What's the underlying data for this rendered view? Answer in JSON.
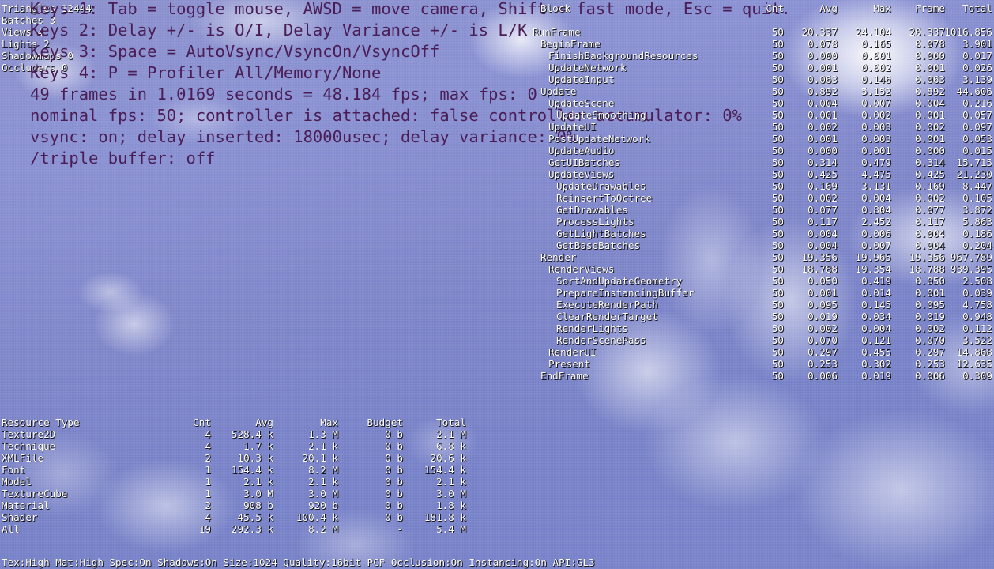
{
  "scene_stats": [
    {
      "label": "Triangles",
      "value": "12444"
    },
    {
      "label": "Batches",
      "value": "3"
    },
    {
      "label": "Views",
      "value": "4"
    },
    {
      "label": "Lights",
      "value": "2"
    },
    {
      "label": "Shadowmaps",
      "value": "0"
    },
    {
      "label": "Occluders",
      "value": "0"
    }
  ],
  "instructions": [
    "Keys 1: Tab = toggle mouse, AWSD = move camera, Shift = fast mode, Esc = quit.",
    "Keys 2: Delay +/- is O/I, Delay Variance +/- is L/K",
    "Keys 3: Space = AutoVsync/VsyncOn/VsyncOff",
    "Keys 4: P = Profiler All/Memory/None",
    "49 frames in 1.0169 seconds = 48.184 fps; max fps: 0",
    "nominal fps: 50; controller is attached: false controller accumulator: 0%",
    "vsync: on; delay inserted: 18000usec; delay variance: 0%",
    "/triple buffer: off"
  ],
  "profiler": {
    "headers": {
      "block": "Block",
      "cnt": "Cnt",
      "avg": "Avg",
      "max": "Max",
      "frame": "Frame",
      "total": "Total"
    },
    "rows": [
      {
        "block": "RunFrame",
        "depth": 0,
        "cnt": "50",
        "avg": "20.337",
        "max": "24.104",
        "frame": "20.337",
        "total": "1016.856"
      },
      {
        "block": "BeginFrame",
        "depth": 1,
        "cnt": "50",
        "avg": "0.078",
        "max": "0.165",
        "frame": "0.078",
        "total": "3.901"
      },
      {
        "block": "FinishBackgroundResources",
        "depth": 2,
        "cnt": "50",
        "avg": "0.000",
        "max": "0.001",
        "frame": "0.000",
        "total": "0.017"
      },
      {
        "block": "UpdateNetwork",
        "depth": 2,
        "cnt": "50",
        "avg": "0.001",
        "max": "0.002",
        "frame": "0.001",
        "total": "0.026"
      },
      {
        "block": "UpdateInput",
        "depth": 2,
        "cnt": "50",
        "avg": "0.063",
        "max": "0.146",
        "frame": "0.063",
        "total": "3.139"
      },
      {
        "block": "Update",
        "depth": 1,
        "cnt": "50",
        "avg": "0.892",
        "max": "5.152",
        "frame": "0.892",
        "total": "44.606"
      },
      {
        "block": "UpdateScene",
        "depth": 2,
        "cnt": "50",
        "avg": "0.004",
        "max": "0.007",
        "frame": "0.004",
        "total": "0.216"
      },
      {
        "block": "UpdateSmoothing",
        "depth": 3,
        "cnt": "50",
        "avg": "0.001",
        "max": "0.002",
        "frame": "0.001",
        "total": "0.057"
      },
      {
        "block": "UpdateUI",
        "depth": 2,
        "cnt": "50",
        "avg": "0.002",
        "max": "0.003",
        "frame": "0.002",
        "total": "0.097"
      },
      {
        "block": "PostUpdateNetwork",
        "depth": 2,
        "cnt": "50",
        "avg": "0.001",
        "max": "0.003",
        "frame": "0.001",
        "total": "0.053"
      },
      {
        "block": "UpdateAudio",
        "depth": 2,
        "cnt": "50",
        "avg": "0.000",
        "max": "0.001",
        "frame": "0.000",
        "total": "0.015"
      },
      {
        "block": "GetUIBatches",
        "depth": 2,
        "cnt": "50",
        "avg": "0.314",
        "max": "0.479",
        "frame": "0.314",
        "total": "15.715"
      },
      {
        "block": "UpdateViews",
        "depth": 2,
        "cnt": "50",
        "avg": "0.425",
        "max": "4.475",
        "frame": "0.425",
        "total": "21.230"
      },
      {
        "block": "UpdateDrawables",
        "depth": 3,
        "cnt": "50",
        "avg": "0.169",
        "max": "3.131",
        "frame": "0.169",
        "total": "8.447"
      },
      {
        "block": "ReinsertToOctree",
        "depth": 3,
        "cnt": "50",
        "avg": "0.002",
        "max": "0.004",
        "frame": "0.002",
        "total": "0.105"
      },
      {
        "block": "GetDrawables",
        "depth": 3,
        "cnt": "50",
        "avg": "0.077",
        "max": "0.804",
        "frame": "0.077",
        "total": "3.872"
      },
      {
        "block": "ProcessLights",
        "depth": 3,
        "cnt": "50",
        "avg": "0.117",
        "max": "2.452",
        "frame": "0.117",
        "total": "5.863"
      },
      {
        "block": "GetLightBatches",
        "depth": 3,
        "cnt": "50",
        "avg": "0.004",
        "max": "0.006",
        "frame": "0.004",
        "total": "0.186"
      },
      {
        "block": "GetBaseBatches",
        "depth": 3,
        "cnt": "50",
        "avg": "0.004",
        "max": "0.007",
        "frame": "0.004",
        "total": "0.204"
      },
      {
        "block": "Render",
        "depth": 1,
        "cnt": "50",
        "avg": "19.356",
        "max": "19.965",
        "frame": "19.356",
        "total": "967.789"
      },
      {
        "block": "RenderViews",
        "depth": 2,
        "cnt": "50",
        "avg": "18.788",
        "max": "19.354",
        "frame": "18.788",
        "total": "939.395"
      },
      {
        "block": "SortAndUpdateGeometry",
        "depth": 3,
        "cnt": "50",
        "avg": "0.050",
        "max": "0.419",
        "frame": "0.050",
        "total": "2.508"
      },
      {
        "block": "PrepareInstancingBuffer",
        "depth": 3,
        "cnt": "50",
        "avg": "0.001",
        "max": "0.014",
        "frame": "0.001",
        "total": "0.039"
      },
      {
        "block": "ExecuteRenderPath",
        "depth": 3,
        "cnt": "50",
        "avg": "0.095",
        "max": "0.145",
        "frame": "0.095",
        "total": "4.758"
      },
      {
        "block": "ClearRenderTarget",
        "depth": 4,
        "cnt": "50",
        "avg": "0.019",
        "max": "0.034",
        "frame": "0.019",
        "total": "0.948"
      },
      {
        "block": "RenderLights",
        "depth": 4,
        "cnt": "50",
        "avg": "0.002",
        "max": "0.004",
        "frame": "0.002",
        "total": "0.112"
      },
      {
        "block": "RenderScenePass",
        "depth": 4,
        "cnt": "50",
        "avg": "0.070",
        "max": "0.121",
        "frame": "0.070",
        "total": "3.522"
      },
      {
        "block": "RenderUI",
        "depth": 2,
        "cnt": "50",
        "avg": "0.297",
        "max": "0.455",
        "frame": "0.297",
        "total": "14.868"
      },
      {
        "block": "Present",
        "depth": 2,
        "cnt": "50",
        "avg": "0.253",
        "max": "0.302",
        "frame": "0.253",
        "total": "12.635"
      },
      {
        "block": "EndFrame",
        "depth": 1,
        "cnt": "50",
        "avg": "0.006",
        "max": "0.019",
        "frame": "0.006",
        "total": "0.309"
      }
    ]
  },
  "resources": {
    "headers": {
      "type": "Resource Type",
      "cnt": "Cnt",
      "avg": "Avg",
      "max": "Max",
      "budget": "Budget",
      "total": "Total"
    },
    "rows": [
      {
        "type": "Texture2D",
        "cnt": "4",
        "avg": "528.4 k",
        "max": "1.3 M",
        "budget": "0 b",
        "total": "2.1 M"
      },
      {
        "type": "Technique",
        "cnt": "4",
        "avg": "1.7 k",
        "max": "2.1 k",
        "budget": "0 b",
        "total": "6.8 k"
      },
      {
        "type": "XMLFile",
        "cnt": "2",
        "avg": "10.3 k",
        "max": "20.1 k",
        "budget": "0 b",
        "total": "20.6 k"
      },
      {
        "type": "Font",
        "cnt": "1",
        "avg": "154.4 k",
        "max": "8.2 M",
        "budget": "0 b",
        "total": "154.4 k"
      },
      {
        "type": "Model",
        "cnt": "1",
        "avg": "2.1 k",
        "max": "2.1 k",
        "budget": "0 b",
        "total": "2.1 k"
      },
      {
        "type": "TextureCube",
        "cnt": "1",
        "avg": "3.0 M",
        "max": "3.0 M",
        "budget": "0 b",
        "total": "3.0 M"
      },
      {
        "type": "Material",
        "cnt": "2",
        "avg": "908 b",
        "max": "920 b",
        "budget": "0 b",
        "total": "1.8 k"
      },
      {
        "type": "Shader",
        "cnt": "4",
        "avg": "45.5 k",
        "max": "100.4 k",
        "budget": "0 b",
        "total": "181.8 k"
      },
      {
        "type": "All",
        "cnt": "19",
        "avg": "292.3 k",
        "max": "8.2 M",
        "budget": "-",
        "total": "5.4 M"
      }
    ]
  },
  "status_bar": {
    "text": "Tex:High Mat:High Spec:On Shadows:On Size:1024 Quality:16bit PCF Occlusion:On Instancing:On API:GL3"
  },
  "colors": {
    "debug_text": "#ffffff",
    "instruction_text": "#4a1e55",
    "sky": "#8289ca"
  }
}
